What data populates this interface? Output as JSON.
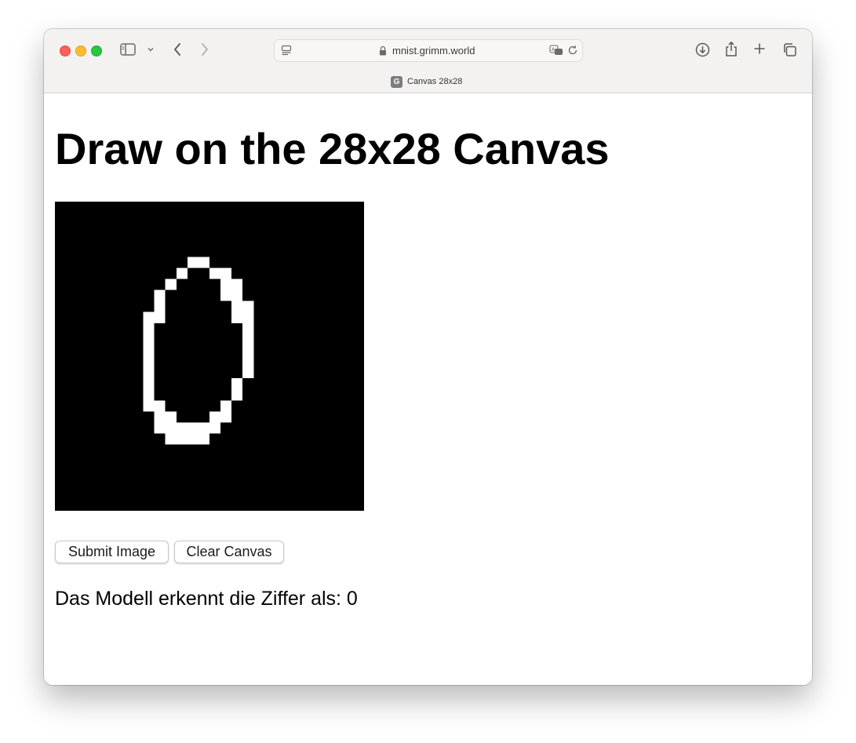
{
  "browser": {
    "url": "mnist.grimm.world",
    "tab_title": "Canvas 28x28",
    "favicon_letter": "G"
  },
  "page": {
    "title": "Draw on the 28x28 Canvas",
    "submit_label": "Submit Image",
    "clear_label": "Clear Canvas",
    "result_text": "Das Modell erkennt die Ziffer als: 0"
  },
  "canvas": {
    "grid_size": 28,
    "background": "#000000",
    "ink": "#ffffff",
    "rows": [
      {
        "row": 5,
        "spans": [
          [
            12,
            14
          ]
        ]
      },
      {
        "row": 6,
        "spans": [
          [
            11,
            12
          ],
          [
            14,
            16
          ]
        ]
      },
      {
        "row": 7,
        "spans": [
          [
            10,
            11
          ],
          [
            15,
            17
          ]
        ]
      },
      {
        "row": 8,
        "spans": [
          [
            9,
            10
          ],
          [
            15,
            17
          ]
        ]
      },
      {
        "row": 9,
        "spans": [
          [
            9,
            10
          ],
          [
            16,
            18
          ]
        ]
      },
      {
        "row": 10,
        "spans": [
          [
            8,
            10
          ],
          [
            16,
            18
          ]
        ]
      },
      {
        "row": 11,
        "spans": [
          [
            8,
            9
          ],
          [
            17,
            18
          ]
        ]
      },
      {
        "row": 12,
        "spans": [
          [
            8,
            9
          ],
          [
            17,
            18
          ]
        ]
      },
      {
        "row": 13,
        "spans": [
          [
            8,
            9
          ],
          [
            17,
            18
          ]
        ]
      },
      {
        "row": 14,
        "spans": [
          [
            8,
            9
          ],
          [
            17,
            18
          ]
        ]
      },
      {
        "row": 15,
        "spans": [
          [
            8,
            9
          ],
          [
            17,
            18
          ]
        ]
      },
      {
        "row": 16,
        "spans": [
          [
            8,
            9
          ],
          [
            16,
            17
          ]
        ]
      },
      {
        "row": 17,
        "spans": [
          [
            8,
            9
          ],
          [
            16,
            17
          ]
        ]
      },
      {
        "row": 18,
        "spans": [
          [
            8,
            10
          ],
          [
            15,
            16
          ]
        ]
      },
      {
        "row": 19,
        "spans": [
          [
            9,
            11
          ],
          [
            14,
            16
          ]
        ]
      },
      {
        "row": 20,
        "spans": [
          [
            9,
            15
          ]
        ]
      },
      {
        "row": 21,
        "spans": [
          [
            10,
            14
          ]
        ]
      }
    ]
  },
  "colors": {
    "close": "#fe5f57",
    "minimize": "#febc2e",
    "maximize": "#28c840"
  },
  "icons": [
    "sidebar-icon",
    "chevron-down-icon",
    "back-icon",
    "forward-icon",
    "page-menu-icon",
    "lock-icon",
    "translate-icon",
    "reload-icon",
    "download-icon",
    "share-icon",
    "new-tab-icon",
    "tab-overview-icon"
  ]
}
